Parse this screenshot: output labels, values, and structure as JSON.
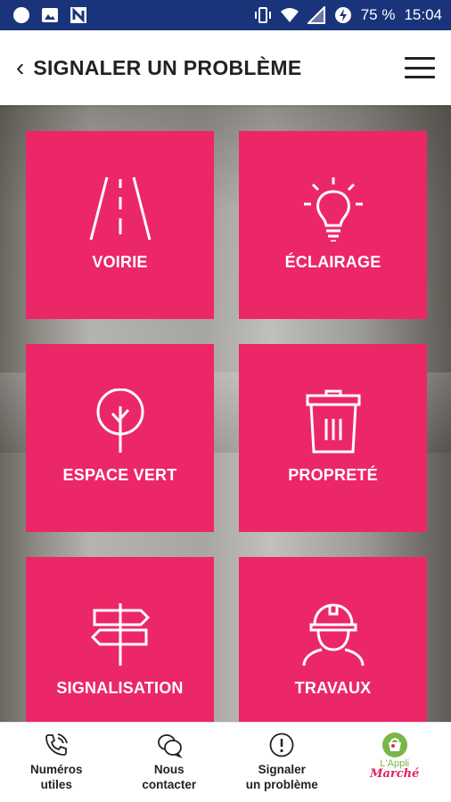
{
  "status_bar": {
    "battery": "75 %",
    "time": "15:04"
  },
  "header": {
    "title": "SIGNALER UN PROBLÈME"
  },
  "tiles": [
    {
      "label": "VOIRIE",
      "icon": "road-icon"
    },
    {
      "label": "ÉCLAIRAGE",
      "icon": "lightbulb-icon"
    },
    {
      "label": "ESPACE VERT",
      "icon": "tree-icon"
    },
    {
      "label": "PROPRETÉ",
      "icon": "trash-icon"
    },
    {
      "label": "SIGNALISATION",
      "icon": "signpost-icon"
    },
    {
      "label": "TRAVAUX",
      "icon": "worker-icon"
    }
  ],
  "bottom_nav": [
    {
      "label": "Numéros\nutiles",
      "icon": "phone-icon"
    },
    {
      "label": "Nous\ncontacter",
      "icon": "chat-icon"
    },
    {
      "label": "Signaler\nun problème",
      "icon": "alert-icon"
    }
  ],
  "logo": {
    "top": "L'Appli",
    "bottom": "Marché"
  },
  "colors": {
    "status_bar": "#19347a",
    "tile": "#ec2767",
    "logo_green": "#7ab648",
    "logo_pink": "#e02462"
  }
}
